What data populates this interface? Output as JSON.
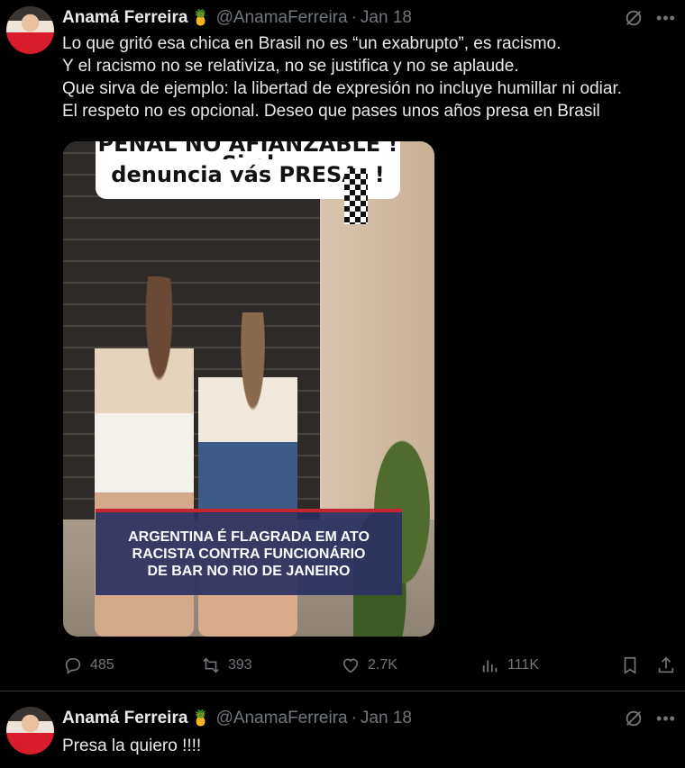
{
  "tweets": [
    {
      "author_name": "Anamá Ferreira",
      "author_emoji": "🍍",
      "handle": "@AnamaFerreira",
      "separator": "·",
      "date": "Jan 18",
      "text_lines": [
        "Lo que gritó esa chica en Brasil no es “un exabrupto”, es racismo.",
        "Y el racismo no se relativiza, no se justifica y no se aplaude.",
        "Que sirva de ejemplo: la libertad de expresión no incluye humillar ni odiar.",
        "El respeto no es opcional. Deseo que pases unos años presa en Brasil"
      ],
      "media": {
        "caption_top_line1": "PENAL NO AFIANZABLE ! Si el",
        "caption_top_line2": "denuncia vás PRESA. !",
        "banner_lines": [
          "ARGENTINA É FLAGRADA EM ATO",
          "RACISTA CONTRA FUNCIONÁRIO",
          "DE BAR NO RIO DE JANEIRO"
        ]
      },
      "stats": {
        "replies": "485",
        "reposts": "393",
        "likes": "2.7K",
        "views": "111K"
      }
    },
    {
      "author_name": "Anamá Ferreira",
      "author_emoji": "🍍",
      "handle": "@AnamaFerreira",
      "separator": "·",
      "date": "Jan 18",
      "text_lines": [
        "Presa la quiero !!!!"
      ]
    }
  ],
  "icons": {
    "more": "•••",
    "grok": "grok-icon",
    "reply": "reply-icon",
    "repost": "repost-icon",
    "like": "heart-icon",
    "views": "views-icon",
    "bookmark": "bookmark-icon",
    "share": "share-icon"
  },
  "colors": {
    "background": "#000000",
    "text": "#e7e9ea",
    "muted": "#71767b",
    "divider": "#2f3336"
  }
}
